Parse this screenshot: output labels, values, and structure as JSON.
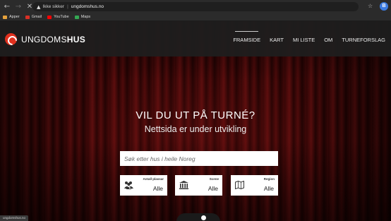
{
  "browser": {
    "security_label": "Ikke sikker",
    "url": "ungdomshus.no",
    "avatar_initial": "B",
    "bookmarks": [
      {
        "label": "Apper",
        "color": "#e6a23c"
      },
      {
        "label": "Gmail",
        "color": "#d93025"
      },
      {
        "label": "YouTube",
        "color": "#ff0000"
      },
      {
        "label": "Maps",
        "color": "#34a853"
      }
    ],
    "status_url": "ungdomshus.no"
  },
  "site": {
    "logo": {
      "part1": "UNGDOMS",
      "part2": "HUS"
    },
    "menu": [
      {
        "label": "FRAMSIDE",
        "active": true
      },
      {
        "label": "KART",
        "active": false
      },
      {
        "label": "MI LISTE",
        "active": false
      },
      {
        "label": "OM",
        "active": false
      },
      {
        "label": "TURNEFORSLAG",
        "active": false
      }
    ],
    "hero": {
      "title": "VIL DU UT PÅ TURNÉ?",
      "subtitle": "Nettsida er under utvikling"
    },
    "search": {
      "placeholder": "Søk etter hus i heile Noreg",
      "value": ""
    },
    "filters": [
      {
        "label": "Antall plassar",
        "value": "Alle",
        "icon": "people-icon"
      },
      {
        "label": "Scene",
        "value": "Alle",
        "icon": "building-icon"
      },
      {
        "label": "Region",
        "value": "Alle",
        "icon": "map-icon"
      }
    ]
  }
}
